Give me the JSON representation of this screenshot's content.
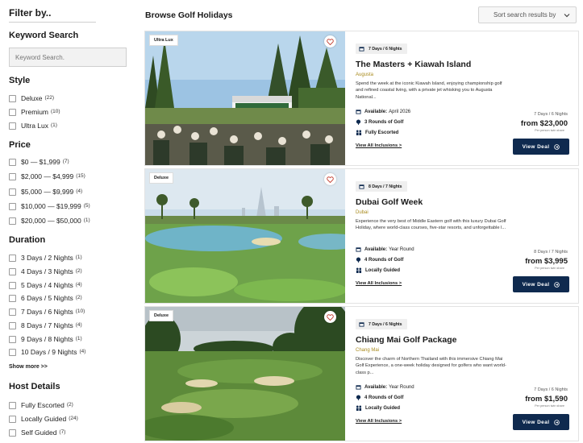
{
  "sidebar": {
    "filter_title": "Filter by..",
    "keyword": {
      "title": "Keyword Search",
      "placeholder": "Keyword Search."
    },
    "style": {
      "title": "Style",
      "options": [
        {
          "label": "Deluxe",
          "count": "(22)"
        },
        {
          "label": "Premium",
          "count": "(10)"
        },
        {
          "label": "Ultra Lux",
          "count": "(1)"
        }
      ]
    },
    "price": {
      "title": "Price",
      "options": [
        {
          "label": "$0 — $1,999",
          "count": "(7)"
        },
        {
          "label": "$2,000 — $4,999",
          "count": "(15)"
        },
        {
          "label": "$5,000 — $9,999",
          "count": "(4)"
        },
        {
          "label": "$10,000 — $19,999",
          "count": "(5)"
        },
        {
          "label": "$20,000 — $50,000",
          "count": "(1)"
        }
      ]
    },
    "duration": {
      "title": "Duration",
      "options": [
        {
          "label": "3 Days / 2 Nights",
          "count": "(1)"
        },
        {
          "label": "4 Days / 3 Nights",
          "count": "(2)"
        },
        {
          "label": "5 Days / 4 Nights",
          "count": "(4)"
        },
        {
          "label": "6 Days / 5 Nights",
          "count": "(2)"
        },
        {
          "label": "7 Days / 6 Nights",
          "count": "(10)"
        },
        {
          "label": "8 Days / 7 Nights",
          "count": "(4)"
        },
        {
          "label": "9 Days / 8 Nights",
          "count": "(1)"
        },
        {
          "label": "10 Days / 9 Nights",
          "count": "(4)"
        }
      ]
    },
    "show_more": "Show more >>",
    "host": {
      "title": "Host Details",
      "options": [
        {
          "label": "Fully Escorted",
          "count": "(2)"
        },
        {
          "label": "Locally Guided",
          "count": "(24)"
        },
        {
          "label": "Self Guided",
          "count": "(7)"
        }
      ]
    }
  },
  "header": {
    "title": "Browse Golf Holidays",
    "sort_label": "Sort search results by"
  },
  "cards": [
    {
      "badge": "Ultra Lux",
      "duration": "7 Days / 6 Nights",
      "title": "The Masters + Kiawah Island",
      "location": "Augusta",
      "description": "Spend the week at the iconic Kiawah Island, enjoying championship golf and refined coastal living, with a private jet whisking you to Augusta National...",
      "available_label": "Available:",
      "available_value": "April 2026",
      "rounds": "3 Rounds of Golf",
      "host": "Fully Escorted",
      "inclusions": "View All Inclusions >",
      "price_duration": "7 Days / 6 Nights",
      "price": "from $23,000",
      "price_note": "Per person twin share",
      "button": "View Deal"
    },
    {
      "badge": "Deluxe",
      "duration": "8 Days / 7 Nights",
      "title": "Dubai Golf Week",
      "location": "Dubai",
      "description": "Experience the very best of Middle Eastern golf with this luxury Dubai Golf Holiday, where world-class courses, five-star resorts, and unforgettable l...",
      "available_label": "Available:",
      "available_value": "Year Round",
      "rounds": "4 Rounds of Golf",
      "host": "Locally Guided",
      "inclusions": "View All Inclusions >",
      "price_duration": "8 Days / 7 Nights",
      "price": "from $3,995",
      "price_note": "Per person twin share",
      "button": "View Deal"
    },
    {
      "badge": "Deluxe",
      "duration": "7 Days / 6 Nights",
      "title": "Chiang Mai Golf Package",
      "location": "Chang Mai",
      "description": "Discover the charm of Northern Thailand with this immersive Chiang Mai Golf Experience, a one-week holiday designed for golfers who want world-class p...",
      "available_label": "Available:",
      "available_value": "Year Round",
      "rounds": "4 Rounds of Golf",
      "host": "Locally Guided",
      "inclusions": "View All Inclusions >",
      "price_duration": "7 Days / 6 Nights",
      "price": "from $1,590",
      "price_note": "Per person twin share",
      "button": "View Deal"
    }
  ],
  "colors": {
    "accent_navy": "#0f2a4f",
    "location_gold": "#a88a1c",
    "heart_red": "#c0392b"
  }
}
